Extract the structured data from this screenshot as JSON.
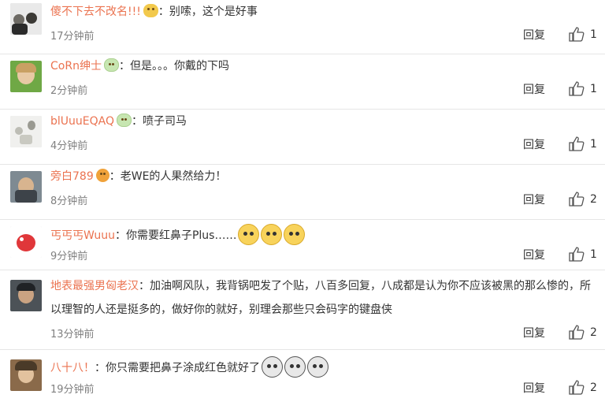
{
  "comments": [
    {
      "username": "傻不下去不改名!!!",
      "badge": "gold",
      "text": "别嗦，这个是好事",
      "time": "17分钟前",
      "reply": "回复",
      "likes": "1",
      "emoticons": []
    },
    {
      "username": "CoRn绅士",
      "badge": "green",
      "text": "但是。。。你戴的下吗",
      "time": "2分钟前",
      "reply": "回复",
      "likes": "1",
      "emoticons": []
    },
    {
      "username": "blUuuEQAQ",
      "badge": "green",
      "text": "喷子司马",
      "time": "4分钟前",
      "reply": "回复",
      "likes": "1",
      "emoticons": []
    },
    {
      "username": "旁白789",
      "badge": "red",
      "text": "老WE的人果然给力！",
      "time": "8分钟前",
      "reply": "回复",
      "likes": "2",
      "emoticons": []
    },
    {
      "username": "丐丐丐Wuuu",
      "badge": "",
      "text": "你需要红鼻子Plus……",
      "time": "9分钟前",
      "reply": "回复",
      "likes": "1",
      "emoticons": [
        "cat-emoticon",
        "cat-emoticon",
        "cat-emoticon"
      ]
    },
    {
      "username": "地表最强男匈老汉",
      "badge": "",
      "text": "加油啊风队，我背锅吧发了个贴，八百多回复，八成都是认为你不应该被黑的那么惨的，所以理智的人还是挺多的，做好你的就好，别理会那些只会码字的键盘侠",
      "time": "13分钟前",
      "reply": "回复",
      "likes": "2",
      "emoticons": []
    },
    {
      "username": "八十八！",
      "badge": "",
      "text": "你只需要把鼻子涂成红色就好了",
      "time": "19分钟前",
      "reply": "回复",
      "likes": "2",
      "emoticons": [
        "clown-emoticon",
        "clown-emoticon",
        "clown-emoticon"
      ]
    }
  ],
  "colors": {
    "username": "#eb7350",
    "time": "#808080",
    "divider": "#e6e6e6"
  }
}
